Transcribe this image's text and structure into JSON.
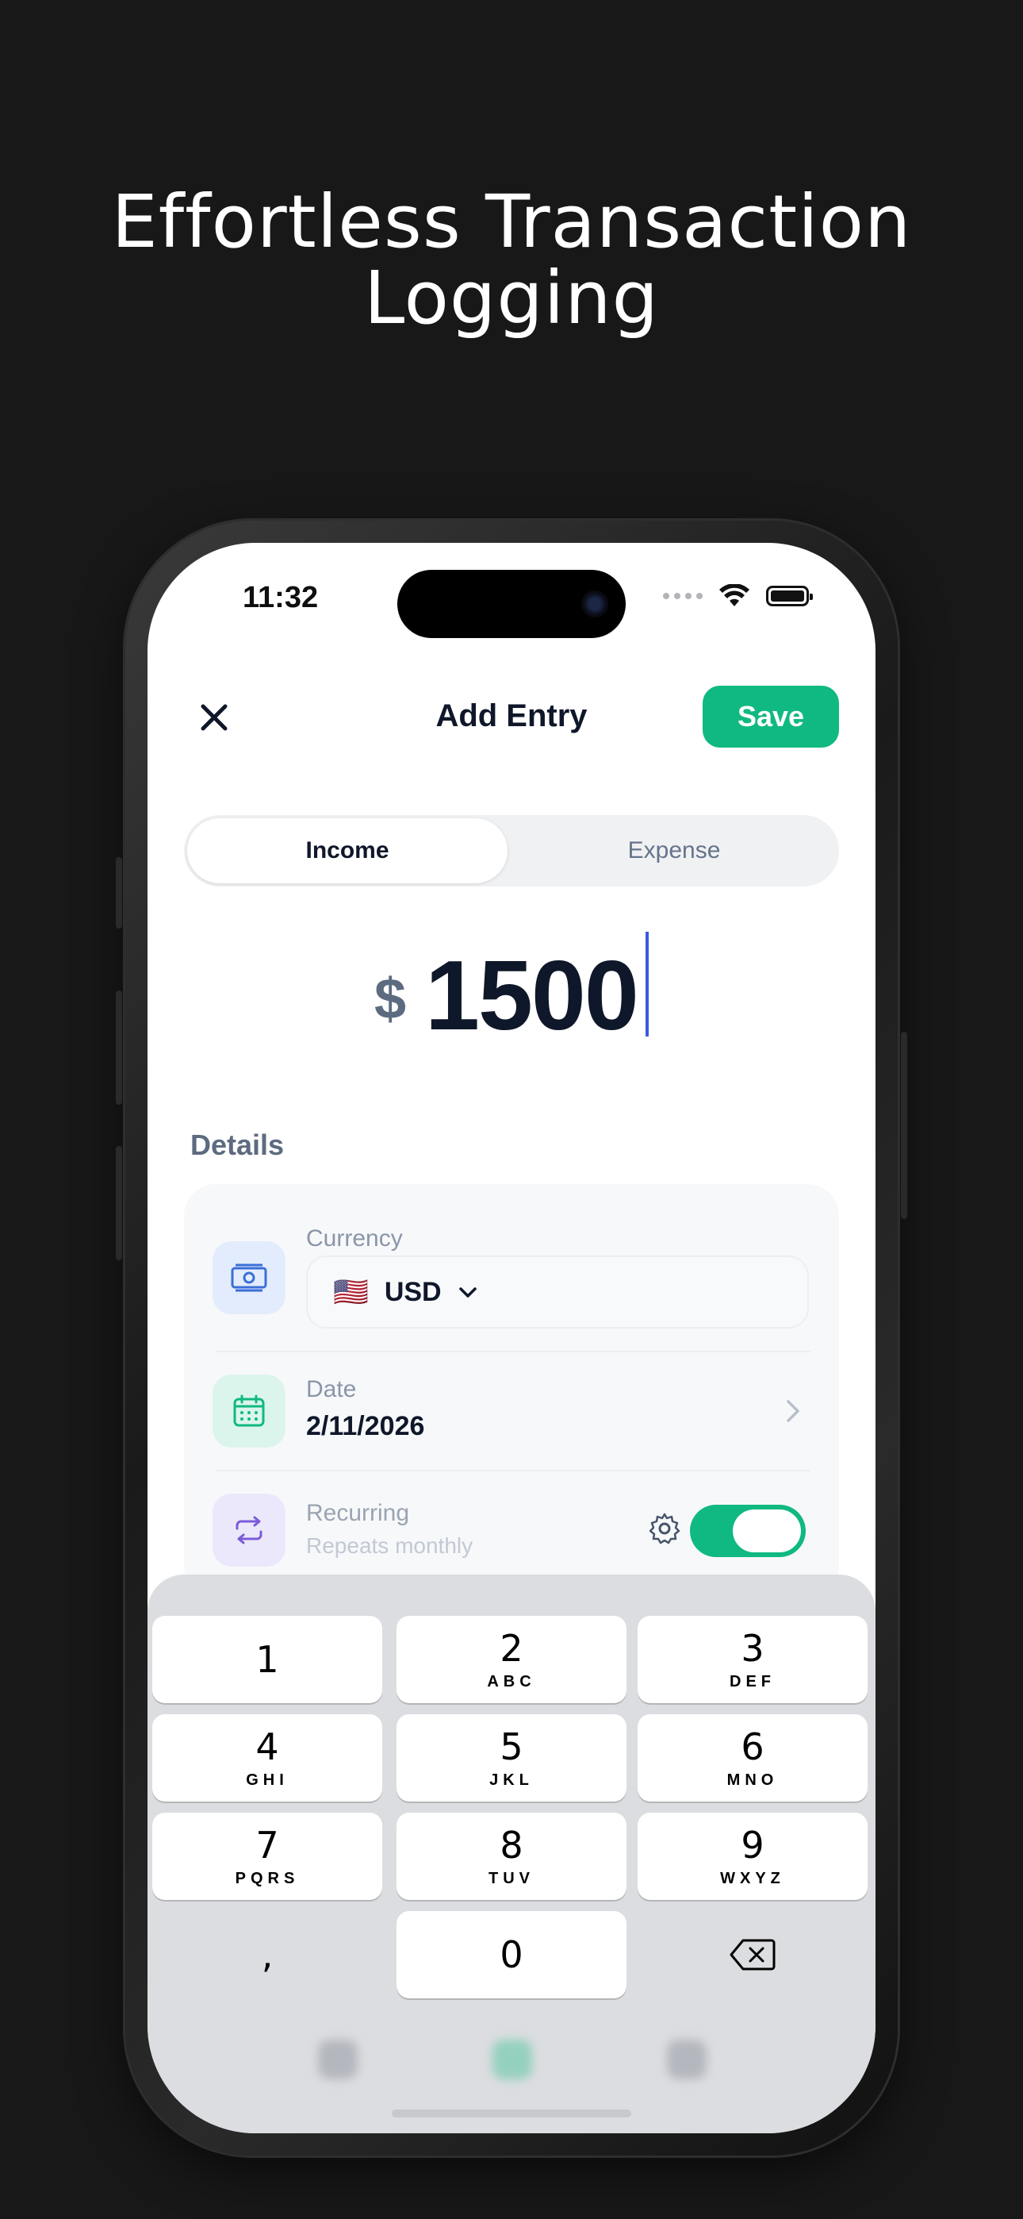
{
  "headline": {
    "line1": "Effortless Transaction",
    "line2": "Logging"
  },
  "status_bar": {
    "time": "11:32"
  },
  "nav": {
    "title": "Add Entry",
    "save_label": "Save"
  },
  "segment": {
    "income_label": "Income",
    "expense_label": "Expense",
    "selected": "Income"
  },
  "amount": {
    "currency_symbol": "$",
    "value": "1500"
  },
  "details": {
    "section_label": "Details",
    "currency": {
      "label": "Currency",
      "flag": "🇺🇸",
      "code": "USD"
    },
    "date": {
      "label": "Date",
      "value": "2/11/2026"
    },
    "recurring": {
      "label": "Recurring",
      "sublabel": "Repeats monthly",
      "enabled": true
    }
  },
  "keypad": {
    "keys": [
      {
        "num": "1",
        "letters": ""
      },
      {
        "num": "2",
        "letters": "ABC"
      },
      {
        "num": "3",
        "letters": "DEF"
      },
      {
        "num": "4",
        "letters": "GHI"
      },
      {
        "num": "5",
        "letters": "JKL"
      },
      {
        "num": "6",
        "letters": "MNO"
      },
      {
        "num": "7",
        "letters": "PQRS"
      },
      {
        "num": "8",
        "letters": "TUV"
      },
      {
        "num": "9",
        "letters": "WXYZ"
      },
      {
        "num": ",",
        "letters": ""
      },
      {
        "num": "0",
        "letters": ""
      }
    ]
  },
  "colors": {
    "accent": "#10b981",
    "background": "#181818",
    "caret": "#3b5bdb"
  }
}
